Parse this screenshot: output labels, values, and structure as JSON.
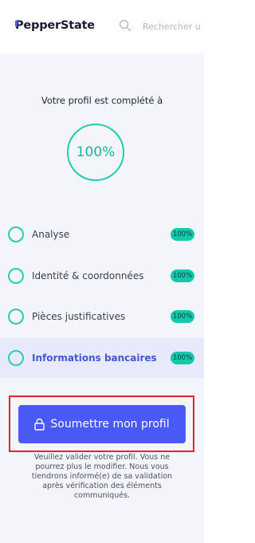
{
  "header": {
    "logo_text": "PepperState",
    "search_icon": "search-icon",
    "search_placeholder": "Rechercher u"
  },
  "profile": {
    "heading": "Votre profil est complété à",
    "progress_label": "100%",
    "progress_fraction": 1.0
  },
  "steps": [
    {
      "label": "Analyse",
      "badge": "100%",
      "active": false
    },
    {
      "label": "Identité & coordonnées",
      "badge": "100%",
      "active": false
    },
    {
      "label": "Pièces justificatives",
      "badge": "100%",
      "active": false
    },
    {
      "label": "Informations bancaires",
      "badge": "100%",
      "active": true
    }
  ],
  "submit": {
    "label": "Soumettre mon profil",
    "icon": "lock-icon",
    "note": "Veuillez valider votre profil. Vous ne pourrez plus le modifier. Nous vous tiendrons informé(e) de sa validation après vérification des éléments communiqués."
  },
  "colors": {
    "accent_blue": "#4859f5",
    "accent_teal": "#12c9ac",
    "highlight_red": "#e0252f",
    "panel_bg": "#f4f4fb"
  }
}
